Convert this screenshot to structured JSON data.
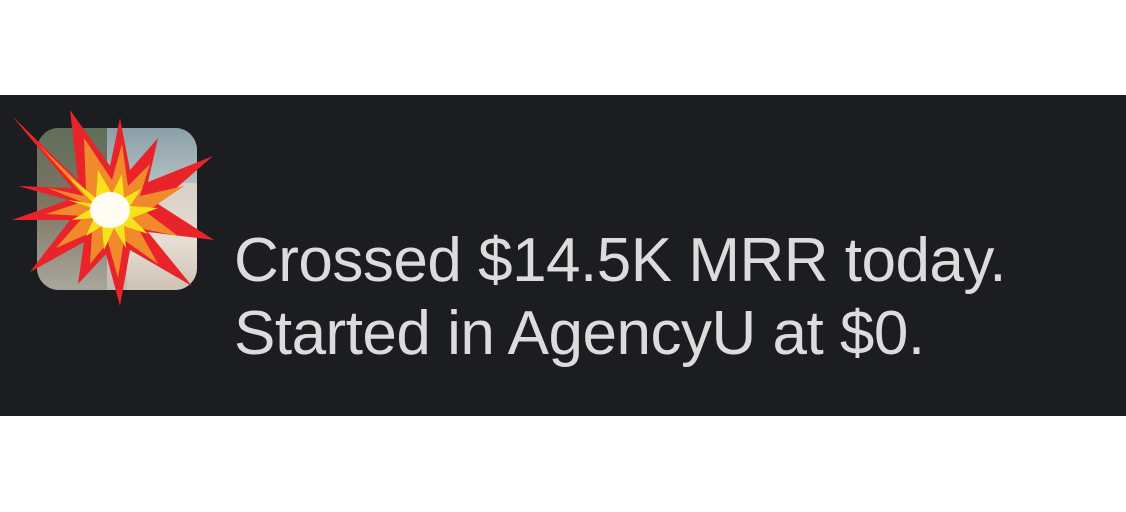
{
  "message": {
    "avatar_icon": "collision-emoji-icon",
    "lines": [
      "Crossed $14.5K MRR today.",
      "Started in AgencyU at $0."
    ]
  },
  "colors": {
    "banner_background": "#1b1d21",
    "text": "#dcdcdc",
    "page_background": "#ffffff"
  }
}
